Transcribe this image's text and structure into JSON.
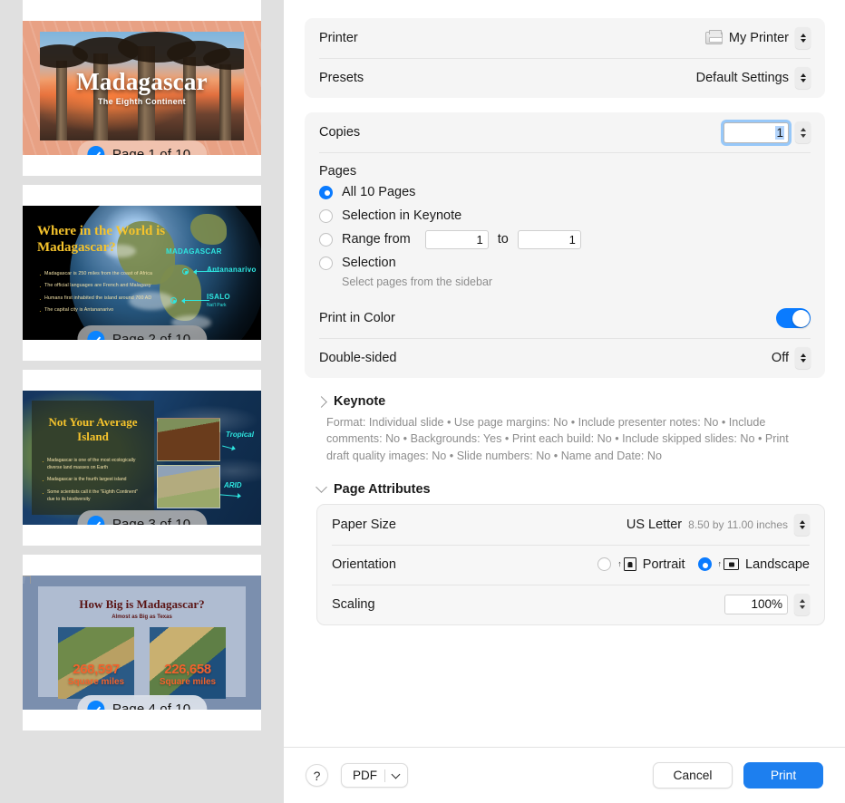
{
  "sidebar": {
    "slides": [
      {
        "page_label": "Page 1 of 10",
        "checked": true,
        "title": "Madagascar",
        "subtitle": "The Eighth Continent"
      },
      {
        "page_label": "Page 2 of 10",
        "checked": true,
        "title": "Where in the World is Madagascar?",
        "bullets": [
          "Madagascar is 250 miles from the coast of Africa",
          "The official languages are French and Malagasy",
          "Humans first inhabited the island around 700 AD",
          "The capital city is Antananarivo"
        ],
        "map_labels": [
          "MADAGASCAR",
          "Antananarivo",
          "ISALO"
        ],
        "map_sublabel": "Nat'l Park"
      },
      {
        "page_label": "Page 3 of 10",
        "checked": true,
        "title": "Not Your Average Island",
        "bullets": [
          "Madagascar is one of the most ecologically diverse land masses on Earth",
          "Madagascar is the fourth largest island",
          "Some scientists call it the \"Eighth Continent\" due to its biodiversity"
        ],
        "annotations": [
          "Tropical",
          "ARID"
        ]
      },
      {
        "page_label": "Page 4 of 10",
        "checked": true,
        "title": "How Big is Madagascar?",
        "subtitle": "Almost as Big as Texas",
        "stats": [
          {
            "number": "268,597",
            "unit": "Square miles"
          },
          {
            "number": "226,658",
            "unit": "Square miles"
          }
        ]
      }
    ]
  },
  "dialog": {
    "printer": {
      "label": "Printer",
      "value": "My Printer",
      "icon": "printer-icon"
    },
    "presets": {
      "label": "Presets",
      "value": "Default Settings"
    },
    "copies": {
      "label": "Copies",
      "value": "1"
    },
    "pages": {
      "label": "Pages",
      "options": [
        {
          "label": "All 10 Pages",
          "selected": true
        },
        {
          "label": "Selection in Keynote",
          "selected": false
        },
        {
          "label": "Range from",
          "selected": false
        },
        {
          "label": "Selection",
          "selected": false
        }
      ],
      "range_from": "1",
      "range_to": "1",
      "to_label": "to",
      "hint": "Select pages from the sidebar"
    },
    "print_in_color": {
      "label": "Print in Color",
      "on": true
    },
    "double_sided": {
      "label": "Double-sided",
      "value": "Off"
    },
    "keynote_section": {
      "title": "Keynote",
      "expanded": false,
      "summary": "Format: Individual slide • Use page margins: No • Include presenter notes: No • Include comments: No • Backgrounds: Yes • Print each build: No • Include skipped slides: No • Print draft quality images: No • Slide numbers: No • Name and Date: No"
    },
    "page_attributes": {
      "title": "Page Attributes",
      "expanded": true,
      "paper_size": {
        "label": "Paper Size",
        "value": "US Letter",
        "dimensions": "8.50 by 11.00 inches"
      },
      "orientation": {
        "label": "Orientation",
        "options": [
          {
            "label": "Portrait",
            "selected": false,
            "icon": "portrait-page-icon"
          },
          {
            "label": "Landscape",
            "selected": true,
            "icon": "landscape-page-icon"
          }
        ]
      },
      "scaling": {
        "label": "Scaling",
        "value": "100%"
      }
    },
    "footer": {
      "help_label": "?",
      "pdf_label": "PDF",
      "cancel_label": "Cancel",
      "print_label": "Print"
    }
  },
  "colors": {
    "accent": "#0a7bff",
    "print_button": "#1d7fef",
    "sidebar_bg": "#e0e0e0",
    "group_bg": "#f5f5f5"
  }
}
